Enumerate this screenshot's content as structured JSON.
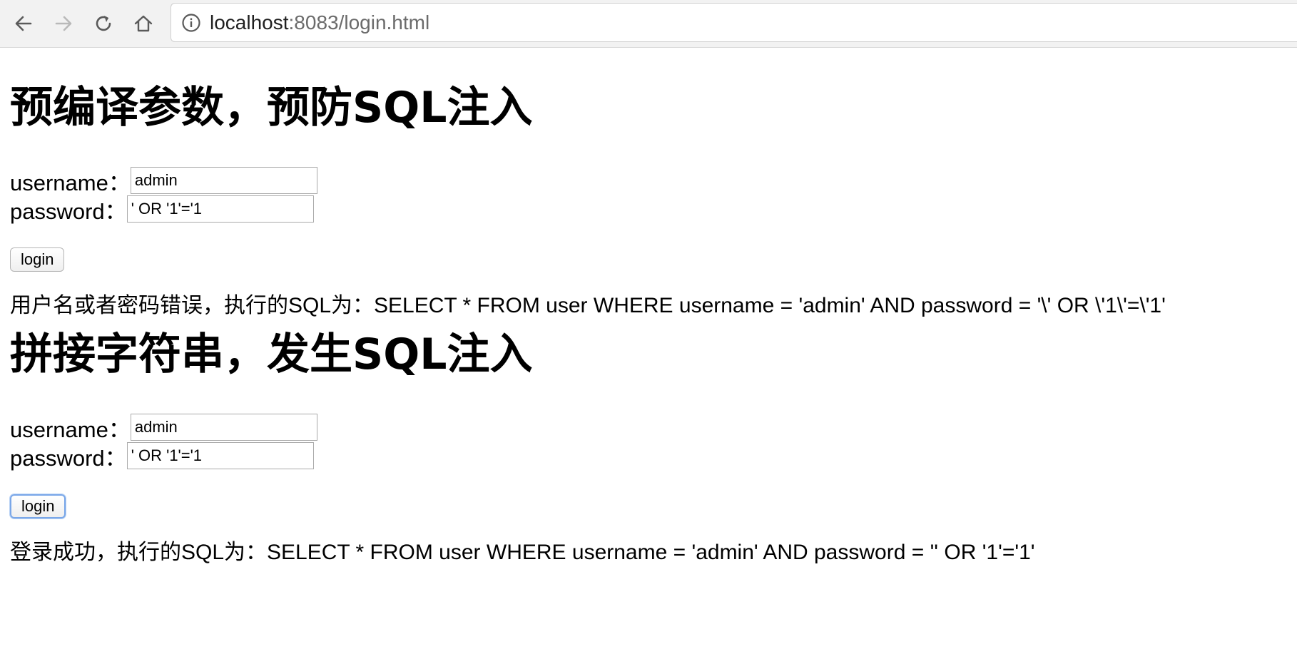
{
  "browser": {
    "url_host": "localhost",
    "url_rest": ":8083/login.html"
  },
  "sections": [
    {
      "title": "预编译参数，预防SQL注入",
      "username_label": "username：",
      "username_value": "admin",
      "password_label": "password：",
      "password_value": "' OR '1'='1",
      "login_label": "login",
      "result": "用户名或者密码错误，执行的SQL为：SELECT * FROM user WHERE username = 'admin' AND password = '\\' OR \\'1\\'=\\'1'"
    },
    {
      "title": "拼接字符串，发生SQL注入",
      "username_label": "username：",
      "username_value": "admin",
      "password_label": "password：",
      "password_value": "' OR '1'='1",
      "login_label": "login",
      "result": "登录成功，执行的SQL为：SELECT * FROM user WHERE username = 'admin' AND password = '' OR '1'='1'"
    }
  ]
}
